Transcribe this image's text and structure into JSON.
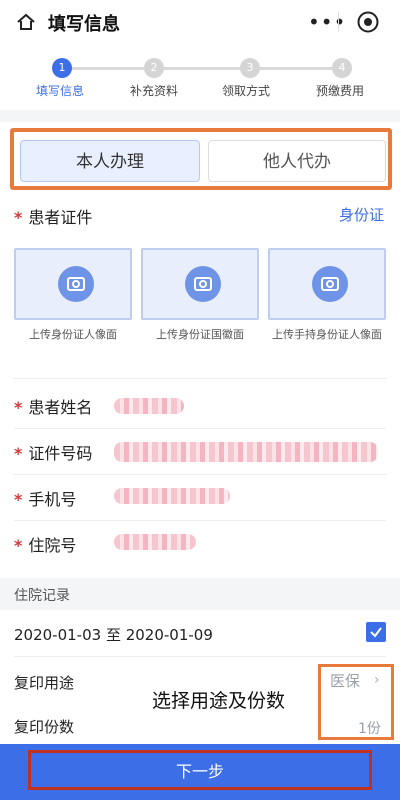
{
  "header": {
    "title": "填写信息",
    "more_label": "•••"
  },
  "steps": [
    {
      "num": "1",
      "label": "填写信息",
      "active": true
    },
    {
      "num": "2",
      "label": "补充资料",
      "active": false
    },
    {
      "num": "3",
      "label": "领取方式",
      "active": false
    },
    {
      "num": "4",
      "label": "预缴费用",
      "active": false
    }
  ],
  "applicant": {
    "self_label": "本人办理",
    "other_label": "他人代办",
    "selected": "self"
  },
  "patient_id": {
    "label": "患者证件",
    "type_value": "身份证",
    "uploads": [
      "上传身份证人像面",
      "上传身份证国徽面",
      "上传手持身份证人像面"
    ]
  },
  "fields": [
    {
      "label": "患者姓名"
    },
    {
      "label": "证件号码"
    },
    {
      "label": "手机号"
    },
    {
      "label": "住院号"
    }
  ],
  "hospital_records": {
    "section_title": "住院记录",
    "record_text": "2020-01-03 至 2020-01-09",
    "checked": true
  },
  "copy": {
    "purpose_label": "复印用途",
    "purpose_value": "医保",
    "count_label": "复印份数",
    "count_value": "1份",
    "annotation": "选择用途及份数"
  },
  "footer": {
    "next_label": "下一步"
  },
  "colors": {
    "accent": "#3c6ee8",
    "highlight_orange": "#e87a3c",
    "highlight_red": "#c0311f",
    "required": "#d23b3b"
  }
}
